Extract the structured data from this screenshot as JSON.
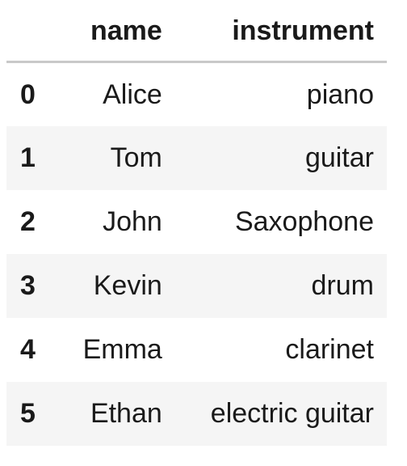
{
  "table": {
    "columns": [
      "name",
      "instrument"
    ],
    "rows": [
      {
        "index": "0",
        "name": "Alice",
        "instrument": "piano"
      },
      {
        "index": "1",
        "name": "Tom",
        "instrument": "guitar"
      },
      {
        "index": "2",
        "name": "John",
        "instrument": "Saxophone"
      },
      {
        "index": "3",
        "name": "Kevin",
        "instrument": "drum"
      },
      {
        "index": "4",
        "name": "Emma",
        "instrument": "clarinet"
      },
      {
        "index": "5",
        "name": "Ethan",
        "instrument": "electric guitar"
      }
    ]
  },
  "colors": {
    "header_rule": "#c9c9c9",
    "stripe": "#f5f5f5",
    "text": "#1a1a1a"
  }
}
